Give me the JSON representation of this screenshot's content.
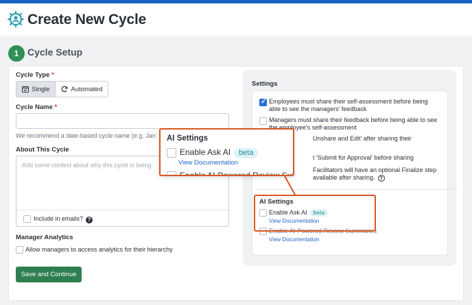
{
  "header": {
    "title": "Create New Cycle"
  },
  "step": {
    "number": "1",
    "title": "Cycle Setup"
  },
  "form": {
    "cycle_type": {
      "label": "Cycle Type",
      "required_mark": "*",
      "options": [
        {
          "label": "Single",
          "icon": "calendar-icon",
          "selected": true
        },
        {
          "label": "Automated",
          "icon": "refresh-icon",
          "selected": false
        }
      ]
    },
    "cycle_name": {
      "label": "Cycle Name",
      "required_mark": "*",
      "value": "",
      "help": "We recommend a date-based cycle name (e.g. Jan"
    },
    "about": {
      "label": "About This Cycle",
      "placeholder": "Add some context about why this cycle is being",
      "include_in_emails": "Include in emails?"
    },
    "manager_analytics": {
      "label": "Manager Analytics",
      "option": "Allow managers to access analytics for their hierarchy"
    },
    "submit_label": "Save and Continue"
  },
  "settings": {
    "title": "Settings",
    "items": [
      {
        "checked": true,
        "text": "Employees must share their self-assessment before being able to see the managers' feedback"
      },
      {
        "checked": false,
        "text": "Managers must share their feedback before being able to see the employee's self-assessment"
      },
      {
        "text": "Unshare and Edit' after sharing their"
      },
      {
        "text": "t 'Submit for Approval' before sharing"
      },
      {
        "text": "Facilitators will have an optional Finalize step available after sharing."
      }
    ],
    "ai": {
      "title": "AI Settings",
      "ask_ai_label": "Enable Ask AI",
      "beta_label": "beta",
      "view_doc_1": "View Documentation",
      "review_summaries_label": "Enable AI-Powered Review Summaries",
      "view_doc_2": "View Documentation"
    }
  },
  "callout": {
    "title": "AI Settings",
    "label": "Enable Ask AI",
    "beta": "beta",
    "link": "View Documentation",
    "cut_label": "Enable AI-Powered Review Summaries"
  },
  "colors": {
    "brand_blue": "#1a5fc4",
    "primary_green": "#2e7f4f",
    "highlight_orange": "#d8571f",
    "link_blue": "#2167c8",
    "beta_bg": "#dff3f6"
  }
}
